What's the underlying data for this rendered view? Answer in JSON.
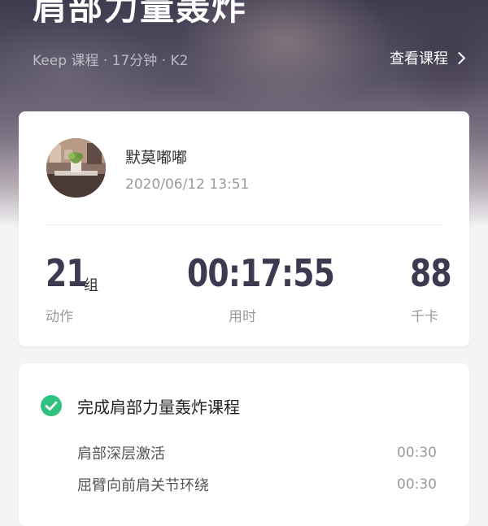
{
  "header": {
    "title": "肩部力量轰炸",
    "subtitle": "Keep 课程 · 17分钟 · K2",
    "view_course_label": "查看课程"
  },
  "profile": {
    "username": "默莫嘟嘟",
    "datetime": "2020/06/12 13:51"
  },
  "stats": {
    "sets": {
      "value": "21",
      "unit": "组",
      "label": "动作"
    },
    "duration": {
      "value": "00:17:55",
      "label": "用时"
    },
    "calories": {
      "value": "88",
      "label": "千卡"
    }
  },
  "course": {
    "status_title": "完成肩部力量轰炸课程",
    "exercises": [
      {
        "name": "肩部深层激活",
        "time": "00:30"
      },
      {
        "name": "屈臂向前肩关节环绕",
        "time": "00:30"
      }
    ]
  },
  "colors": {
    "accent_green": "#2ec27e",
    "stat_text": "#3c3950",
    "hero_dark": "#3f3c50"
  },
  "icons": {
    "view_course": "chevron-right-icon",
    "completed": "check-circle-icon"
  }
}
